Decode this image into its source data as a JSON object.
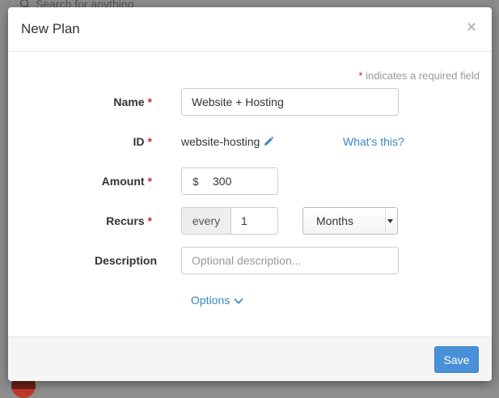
{
  "background": {
    "search_placeholder": "Search for anything",
    "icons": [
      "search-icon"
    ]
  },
  "modal": {
    "title": "New Plan",
    "close_label": "×",
    "required_note": {
      "star": "*",
      "text": " indicates a required field"
    },
    "fields": {
      "name": {
        "label": "Name",
        "required_mark": "*",
        "value": "Website + Hosting"
      },
      "id": {
        "label": "ID",
        "required_mark": "*",
        "value": "website-hosting",
        "help_link": "What's this?"
      },
      "amount": {
        "label": "Amount",
        "required_mark": "*",
        "currency": "$",
        "value": "300"
      },
      "recurs": {
        "label": "Recurs",
        "required_mark": "*",
        "prefix": "every",
        "value": "1",
        "period": "Months"
      },
      "description": {
        "label": "Description",
        "value": "",
        "placeholder": "Optional description..."
      }
    },
    "options_label": "Options",
    "save_label": "Save"
  },
  "colors": {
    "accent": "#3a87c8",
    "primary_button": "#4a90d9",
    "required": "#c9302c"
  },
  "icons": [
    "close-icon",
    "pencil-icon",
    "chevron-down-icon",
    "select-arrow-icon"
  ]
}
